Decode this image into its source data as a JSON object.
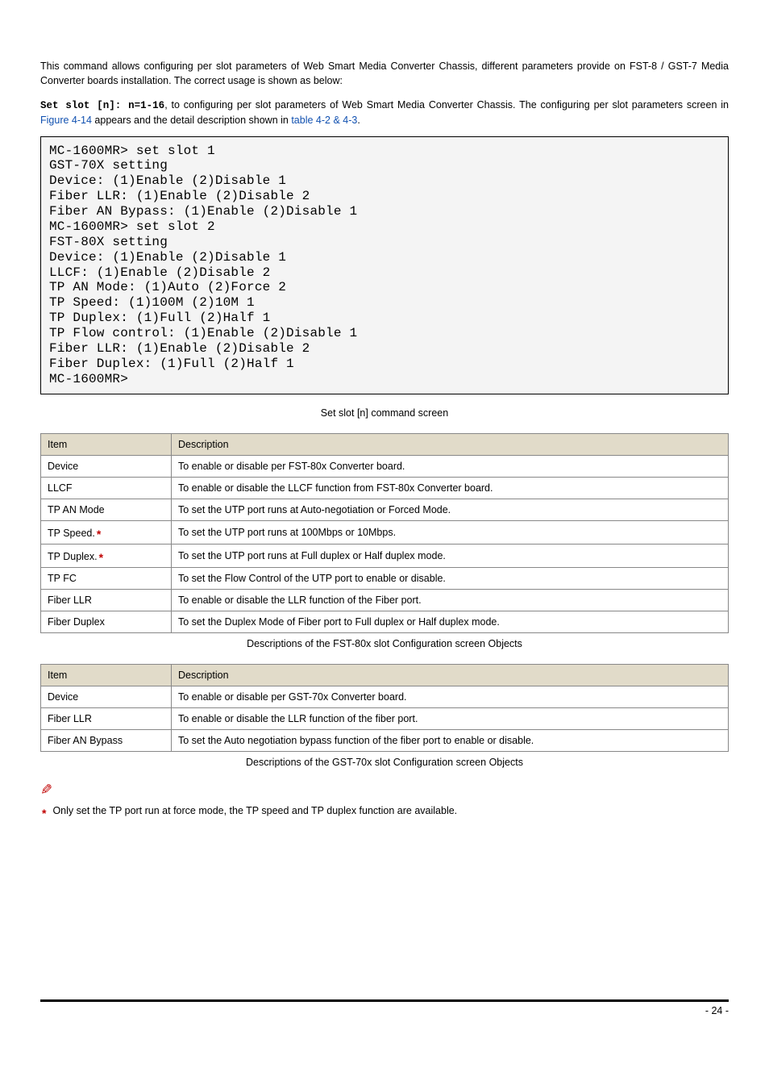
{
  "intro": {
    "p1": "This command allows configuring per slot parameters of Web Smart Media Converter Chassis, different parameters provide on FST-8 / GST-7 Media Converter boards installation. The correct usage is shown as below:",
    "p2_pre": "Set slot [n]: n=1-16",
    "p2_mid1": ", to configuring per slot parameters of Web Smart Media Converter Chassis. The configuring per slot parameters screen in ",
    "p2_link1": "Figure 4-14",
    "p2_mid2": " appears and the detail description shown in ",
    "p2_link2": "table 4-2 & 4-3",
    "p2_end": "."
  },
  "terminal": "MC-1600MR> set slot 1\nGST-70X setting\nDevice: (1)Enable (2)Disable 1\nFiber LLR: (1)Enable (2)Disable 2\nFiber AN Bypass: (1)Enable (2)Disable 1\nMC-1600MR> set slot 2\nFST-80X setting\nDevice: (1)Enable (2)Disable 1\nLLCF: (1)Enable (2)Disable 2\nTP AN Mode: (1)Auto (2)Force 2\nTP Speed: (1)100M (2)10M 1\nTP Duplex: (1)Full (2)Half 1\nTP Flow control: (1)Enable (2)Disable 1\nFiber LLR: (1)Enable (2)Disable 2\nFiber Duplex: (1)Full (2)Half 1\nMC-1600MR>",
  "captions": {
    "terminal": "Set slot [n] command screen",
    "table1": "Descriptions of the FST-80x slot Configuration screen Objects",
    "table2": "Descriptions of the GST-70x slot Configuration screen Objects"
  },
  "headers": {
    "item": "Item",
    "desc": "Description"
  },
  "table1": [
    {
      "item": "Device",
      "star": false,
      "desc": "To enable or disable per FST-80x Converter board."
    },
    {
      "item": "LLCF",
      "star": false,
      "desc": "To enable or disable the LLCF function from FST-80x Converter board."
    },
    {
      "item": "TP AN Mode",
      "star": false,
      "desc": "To set the UTP port runs at Auto-negotiation or Forced Mode."
    },
    {
      "item": "TP Speed.",
      "star": true,
      "desc": "To set the UTP port runs at 100Mbps or 10Mbps."
    },
    {
      "item": "TP Duplex.",
      "star": true,
      "desc": "To set the UTP port runs at Full duplex or Half duplex mode."
    },
    {
      "item": "TP FC",
      "star": false,
      "desc": "To set the Flow Control of the UTP port to enable or disable."
    },
    {
      "item": "Fiber LLR",
      "star": false,
      "desc": "To enable or disable the LLR function of the Fiber port."
    },
    {
      "item": "Fiber Duplex",
      "star": false,
      "desc": "To set the Duplex Mode of Fiber port to Full duplex or Half duplex mode."
    }
  ],
  "table2": [
    {
      "item": "Device",
      "desc": "To enable or disable per GST-70x Converter board."
    },
    {
      "item": "Fiber LLR",
      "desc": "To enable or disable the LLR function of the fiber port."
    },
    {
      "item": "Fiber AN Bypass",
      "desc": "To set the Auto negotiation bypass function of the fiber port to enable or disable."
    }
  ],
  "footnote": {
    "star": "*",
    "text": "Only set the TP port run at force mode, the TP speed and TP duplex function are available."
  },
  "note_icon": "✎",
  "page_number": "- 24 -"
}
